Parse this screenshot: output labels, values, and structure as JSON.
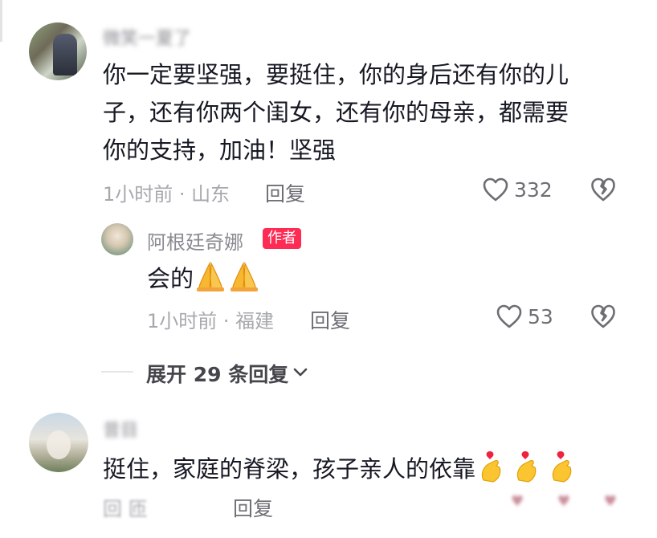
{
  "comments": [
    {
      "username": "微笑一夏了",
      "text_lines": [
        "你一定要坚强，要挺住，你的身后还有你的儿",
        "子，还有你两个闺女，还有你的母亲，都需要",
        "你的支持，加油！坚强"
      ],
      "meta": "1小时前 · 山东",
      "reply_label": "回复",
      "likes": "332"
    },
    {
      "username": "昔目",
      "text": "挺住，家庭的脊梁，孩子亲人的依靠",
      "meta": "回 匝",
      "reply_label": "回复",
      "reactions": "♥ ♥ ♥"
    }
  ],
  "author_reply": {
    "username": "阿根廷奇娜",
    "badge": "作者",
    "text": "会的",
    "meta": "1小时前 · 福建",
    "reply_label": "回复",
    "likes": "53"
  },
  "expand": {
    "label": "展开 29 条回复"
  },
  "colors": {
    "accent": "#fe2c55",
    "text": "#161823",
    "muted": "#a7a8ad",
    "secondary": "#6d6e74"
  },
  "icons": [
    "heart-icon",
    "broken-heart-icon",
    "chevron-down-icon",
    "praying-hands-emoji",
    "finger-heart-emoji"
  ]
}
